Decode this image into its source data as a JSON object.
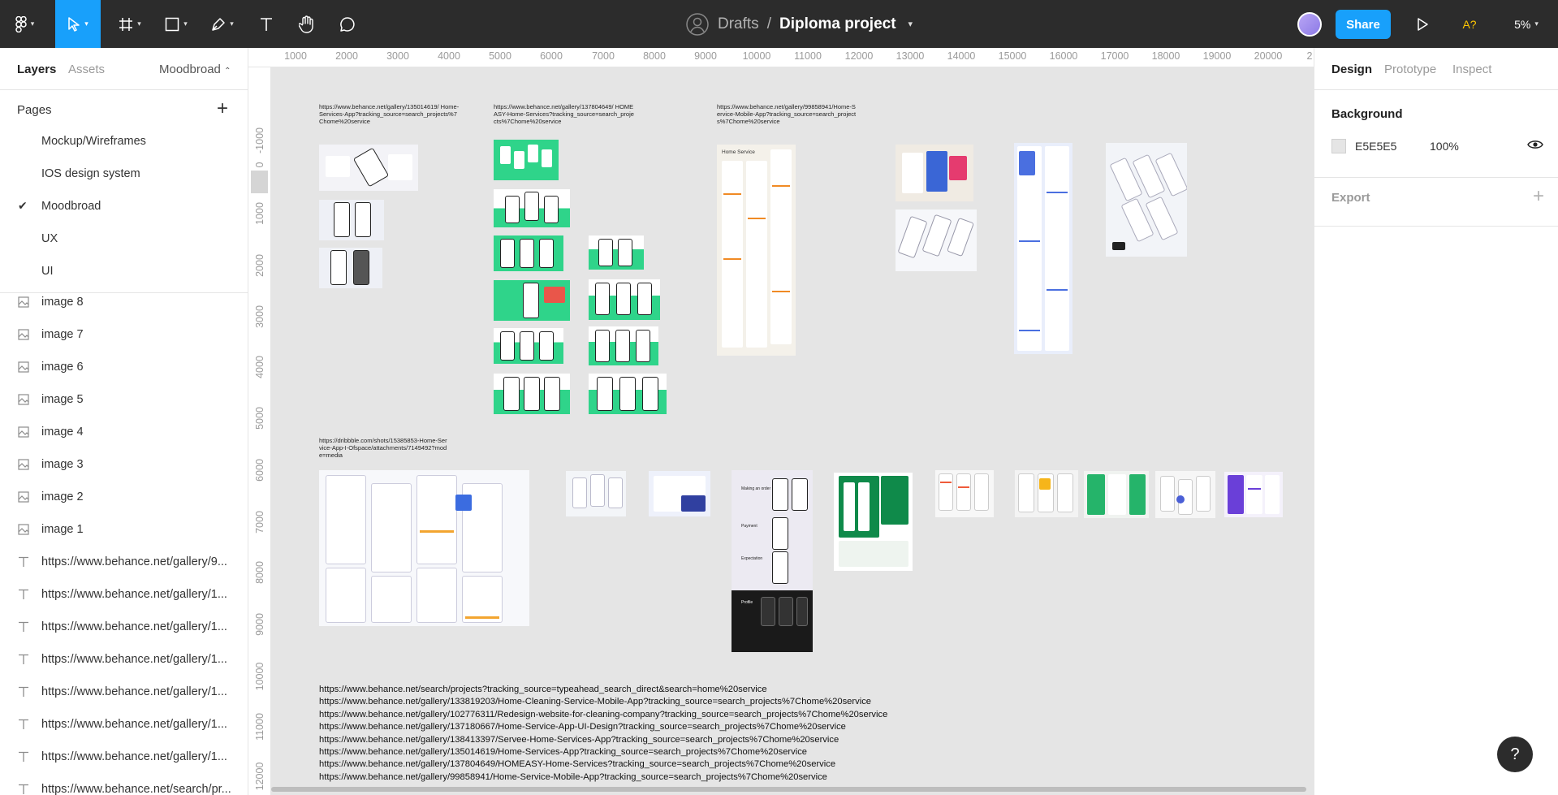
{
  "toolbar": {
    "title_drafts": "Drafts",
    "title_separator": "/",
    "title_name": "Diploma project",
    "share_label": "Share",
    "ai_badge": "A?",
    "zoom_label": "5%"
  },
  "left_panel": {
    "tabs": [
      "Layers",
      "Assets"
    ],
    "page_selector": "Moodbroad",
    "pages_title": "Pages",
    "pages": [
      "Mockup/Wireframes",
      "IOS design system",
      "Moodbroad",
      "UX",
      "UI"
    ],
    "current_page": "Moodbroad",
    "layers": [
      {
        "type": "image",
        "label": "image 8"
      },
      {
        "type": "image",
        "label": "image 7"
      },
      {
        "type": "image",
        "label": "image 6"
      },
      {
        "type": "image",
        "label": "image 5"
      },
      {
        "type": "image",
        "label": "image 4"
      },
      {
        "type": "image",
        "label": "image 3"
      },
      {
        "type": "image",
        "label": "image 2"
      },
      {
        "type": "image",
        "label": "image 1"
      },
      {
        "type": "text",
        "label": "https://www.behance.net/gallery/9..."
      },
      {
        "type": "text",
        "label": "https://www.behance.net/gallery/1..."
      },
      {
        "type": "text",
        "label": "https://www.behance.net/gallery/1..."
      },
      {
        "type": "text",
        "label": "https://www.behance.net/gallery/1..."
      },
      {
        "type": "text",
        "label": "https://www.behance.net/gallery/1..."
      },
      {
        "type": "text",
        "label": "https://www.behance.net/gallery/1..."
      },
      {
        "type": "text",
        "label": "https://www.behance.net/gallery/1..."
      },
      {
        "type": "text",
        "label": "https://www.behance.net/search/pr..."
      }
    ]
  },
  "rulers": {
    "top": [
      "1000",
      "2000",
      "3000",
      "4000",
      "5000",
      "6000",
      "7000",
      "8000",
      "9000",
      "10000",
      "11000",
      "12000",
      "13000",
      "14000",
      "15000",
      "16000",
      "17000",
      "18000",
      "19000",
      "20000",
      "2"
    ],
    "left": [
      "-1000",
      "0",
      "1000",
      "2000",
      "3000",
      "4000",
      "5000",
      "6000",
      "7000",
      "8000",
      "9000",
      "10000",
      "11000",
      "12000"
    ]
  },
  "canvas": {
    "annotations": [
      "https://www.behance.net/gallery/135014619/ Home-Services-App?tracking_source=search_projects%7Chome%20service",
      "https://www.behance.net/gallery/137804649/ HOMEASY-Home-Services?tracking_source=search_projects%7Chome%20service",
      "https://www.behance.net/gallery/99858941/Home-Service-Mobile-App?tracking_source=search_projects%7Chome%20service",
      "https://dribbble.com/shots/15385853-Home-Service-App-I-Ofspace/attachments/7149492?mode=media"
    ],
    "frame_labels": {
      "home_service": "Home Service",
      "making_an_order": "Making an order",
      "payment": "Payment",
      "expectation": "Expectation",
      "profile": "Profile"
    },
    "links": [
      "https://www.behance.net/search/projects?tracking_source=typeahead_search_direct&search=home%20service",
      "https://www.behance.net/gallery/133819203/Home-Cleaning-Service-Mobile-App?tracking_source=search_projects%7Chome%20service",
      "https://www.behance.net/gallery/102776311/Redesign-website-for-cleaning-company?tracking_source=search_projects%7Chome%20service",
      "https://www.behance.net/gallery/137180667/Home-Service-App-UI-Design?tracking_source=search_projects%7Chome%20service",
      "https://www.behance.net/gallery/138413397/Servee-Home-Services-App?tracking_source=search_projects%7Chome%20service",
      "https://www.behance.net/gallery/135014619/Home-Services-App?tracking_source=search_projects%7Chome%20service",
      "https://www.behance.net/gallery/137804649/HOMEASY-Home-Services?tracking_source=search_projects%7Chome%20service",
      "https://www.behance.net/gallery/99858941/Home-Service-Mobile-App?tracking_source=search_projects%7Chome%20service"
    ]
  },
  "right_panel": {
    "tabs": [
      "Design",
      "Prototype",
      "Inspect"
    ],
    "background_title": "Background",
    "background_hex": "E5E5E5",
    "background_opacity": "100%",
    "export_title": "Export"
  },
  "colors": {
    "accent": "#18a0fb",
    "green": "#2fd48a",
    "toolbar_bg": "#2c2c2c",
    "canvas_bg": "#e5e5e5"
  },
  "help_label": "?"
}
